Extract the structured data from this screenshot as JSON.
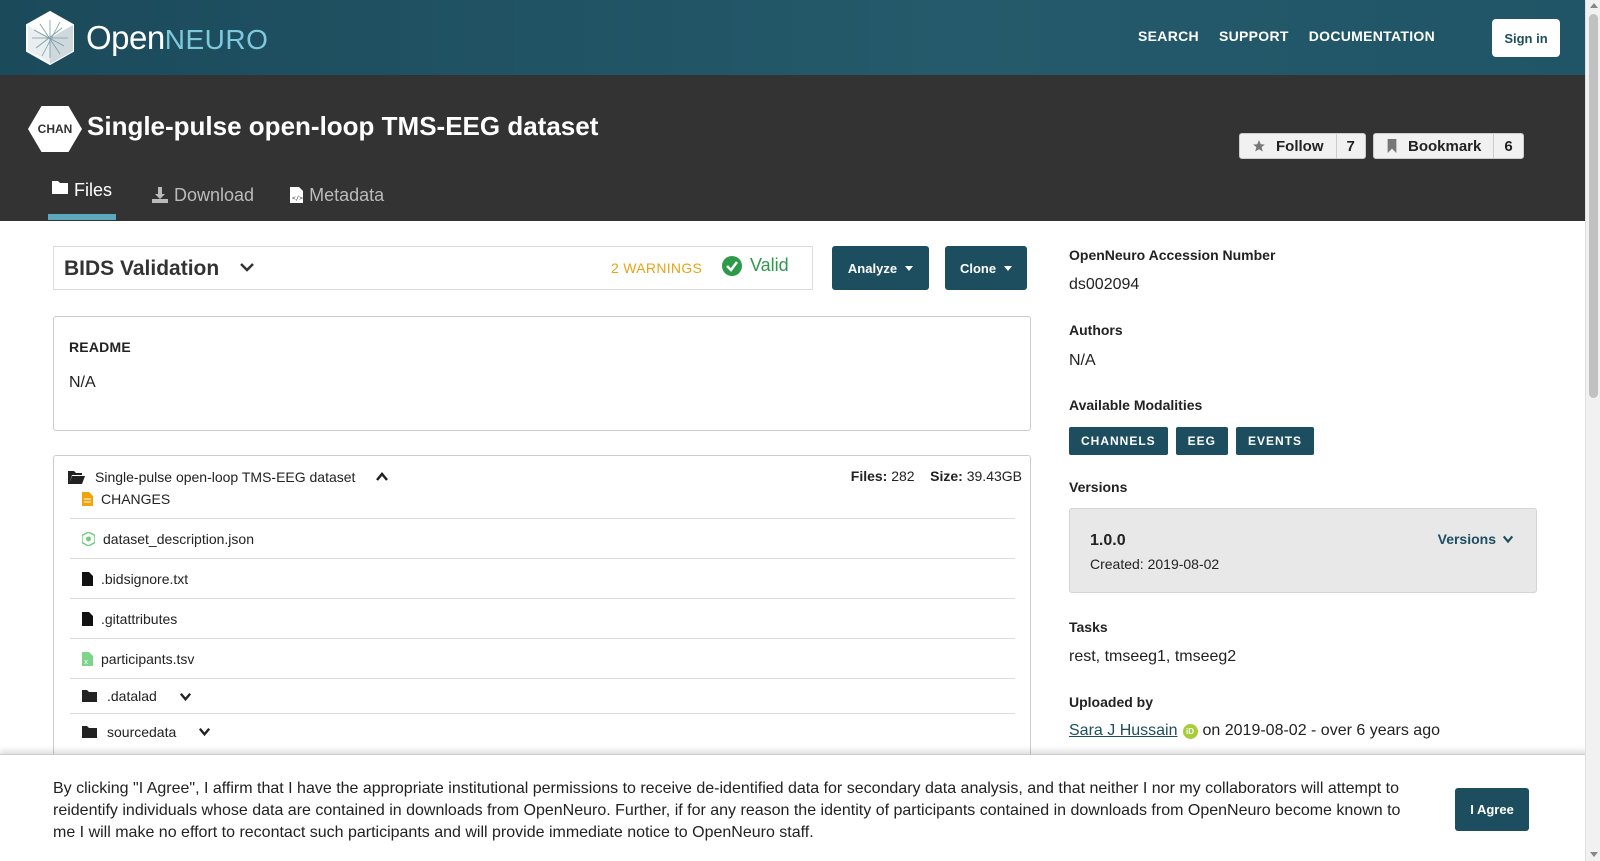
{
  "nav": {
    "brand_open": "Open",
    "brand_neuro": "NEURO",
    "links": [
      "SEARCH",
      "SUPPORT",
      "DOCUMENTATION"
    ],
    "signin": "Sign in"
  },
  "dataset": {
    "badge": "CHAN",
    "title": "Single-pulse open-loop TMS-EEG dataset",
    "follow_label": "Follow",
    "follow_count": "7",
    "bookmark_label": "Bookmark",
    "bookmark_count": "6",
    "tabs": [
      "Files",
      "Download",
      "Metadata"
    ]
  },
  "validation": {
    "title": "BIDS Validation",
    "warnings": "2 WARNINGS",
    "status": "Valid",
    "colors": {
      "warning": "#e8a317",
      "valid": "#2d9a4a"
    }
  },
  "actions": {
    "analyze": "Analyze",
    "clone": "Clone"
  },
  "readme": {
    "heading": "README",
    "content": "N/A"
  },
  "files": {
    "root": "Single-pulse open-loop TMS-EEG dataset",
    "files_label": "Files:",
    "files_count": "282",
    "size_label": "Size:",
    "size_value": "39.43GB",
    "rows": [
      {
        "name": "CHANGES",
        "icon": "file-text-icon"
      },
      {
        "name": "dataset_description.json",
        "icon": "json-file-icon"
      },
      {
        "name": ".bidsignore.txt",
        "icon": "file-icon"
      },
      {
        "name": ".gitattributes",
        "icon": "file-icon"
      },
      {
        "name": "participants.tsv",
        "icon": "spreadsheet-file-icon"
      },
      {
        "name": ".datalad",
        "icon": "folder-icon"
      },
      {
        "name": "sourcedata",
        "icon": "folder-icon"
      }
    ]
  },
  "sidebar": {
    "accession_label": "OpenNeuro Accession Number",
    "accession": "ds002094",
    "authors_label": "Authors",
    "authors": "N/A",
    "modalities_label": "Available Modalities",
    "modalities": [
      "CHANNELS",
      "EEG",
      "EVENTS"
    ],
    "versions_label": "Versions",
    "version": "1.0.0",
    "version_created": "Created: 2019-08-02",
    "versions_button": "Versions",
    "tasks_label": "Tasks",
    "tasks": "rest, tmseeg1, tmseeg2",
    "uploaded_label": "Uploaded by",
    "uploader": "Sara J Hussain",
    "uploaded_on": "on 2019-08-02 - over 6 years ago"
  },
  "consent": {
    "text": "By clicking \"I Agree\", I affirm that I have the appropriate institutional permissions to receive de-identified data for secondary data analysis, and that neither I nor my collaborators will attempt to reidentify individuals whose data are contained in downloads from OpenNeuro. Further, if for any reason the identity of participants contained in downloads from OpenNeuro become known to me I will make no effort to recontact such participants and will provide immediate notice to OpenNeuro staff.",
    "button": "I Agree"
  },
  "colors": {
    "primary": "#1d4e5f",
    "header_dark": "#333333",
    "tab_accent": "#5da8bd"
  }
}
